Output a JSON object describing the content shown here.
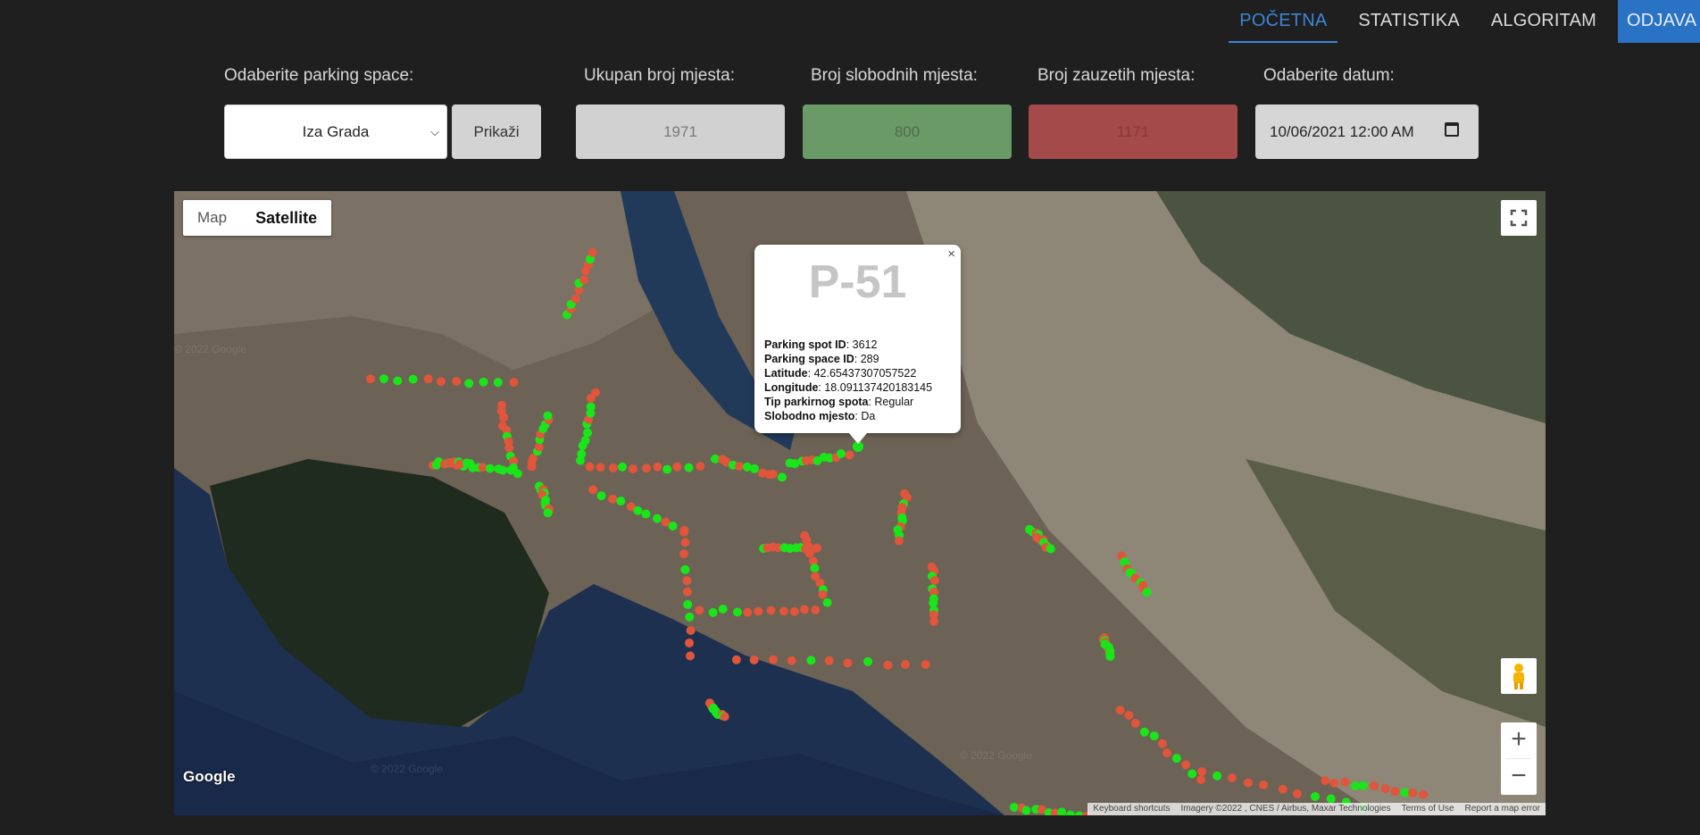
{
  "nav": {
    "items": [
      {
        "label": "POČETNA",
        "active": true
      },
      {
        "label": "STATISTIKA",
        "active": false
      },
      {
        "label": "ALGORITAM",
        "active": false
      }
    ],
    "logout_label": "ODJAVA"
  },
  "controls": {
    "parking_space_label": "Odaberite parking space:",
    "parking_space_value": "Iza Grada",
    "show_button": "Prikaži",
    "total_label": "Ukupan broj mjesta:",
    "total_value": "1971",
    "free_label": "Broj slobodnih mjesta:",
    "free_value": "800",
    "taken_label": "Broj zauzetih mjesta:",
    "taken_value": "1171",
    "date_label": "Odaberite datum:",
    "date_value": "10/06/2021 12:00 AM"
  },
  "map": {
    "type_map": "Map",
    "type_satellite": "Satellite",
    "google": "Google",
    "watermark": "© 2022 Google",
    "attribution": {
      "shortcuts": "Keyboard shortcuts",
      "imagery": "Imagery ©2022 , CNES / Airbus, Maxar Technologies",
      "terms": "Terms of Use",
      "report": "Report a map error"
    },
    "colors": {
      "free": "#19e619",
      "taken": "#e0553b"
    }
  },
  "popup": {
    "title": "P-51",
    "rows": [
      {
        "key": "Parking spot ID",
        "value": "3612"
      },
      {
        "key": "Parking space ID",
        "value": "289"
      },
      {
        "key": "Latitude",
        "value": "42.65437307057522"
      },
      {
        "key": "Longitude",
        "value": "18.091137420183145"
      },
      {
        "key": "Tip parkirnog spota",
        "value": "Regular"
      },
      {
        "key": "Slobodno mjesto",
        "value": "Da"
      }
    ]
  }
}
